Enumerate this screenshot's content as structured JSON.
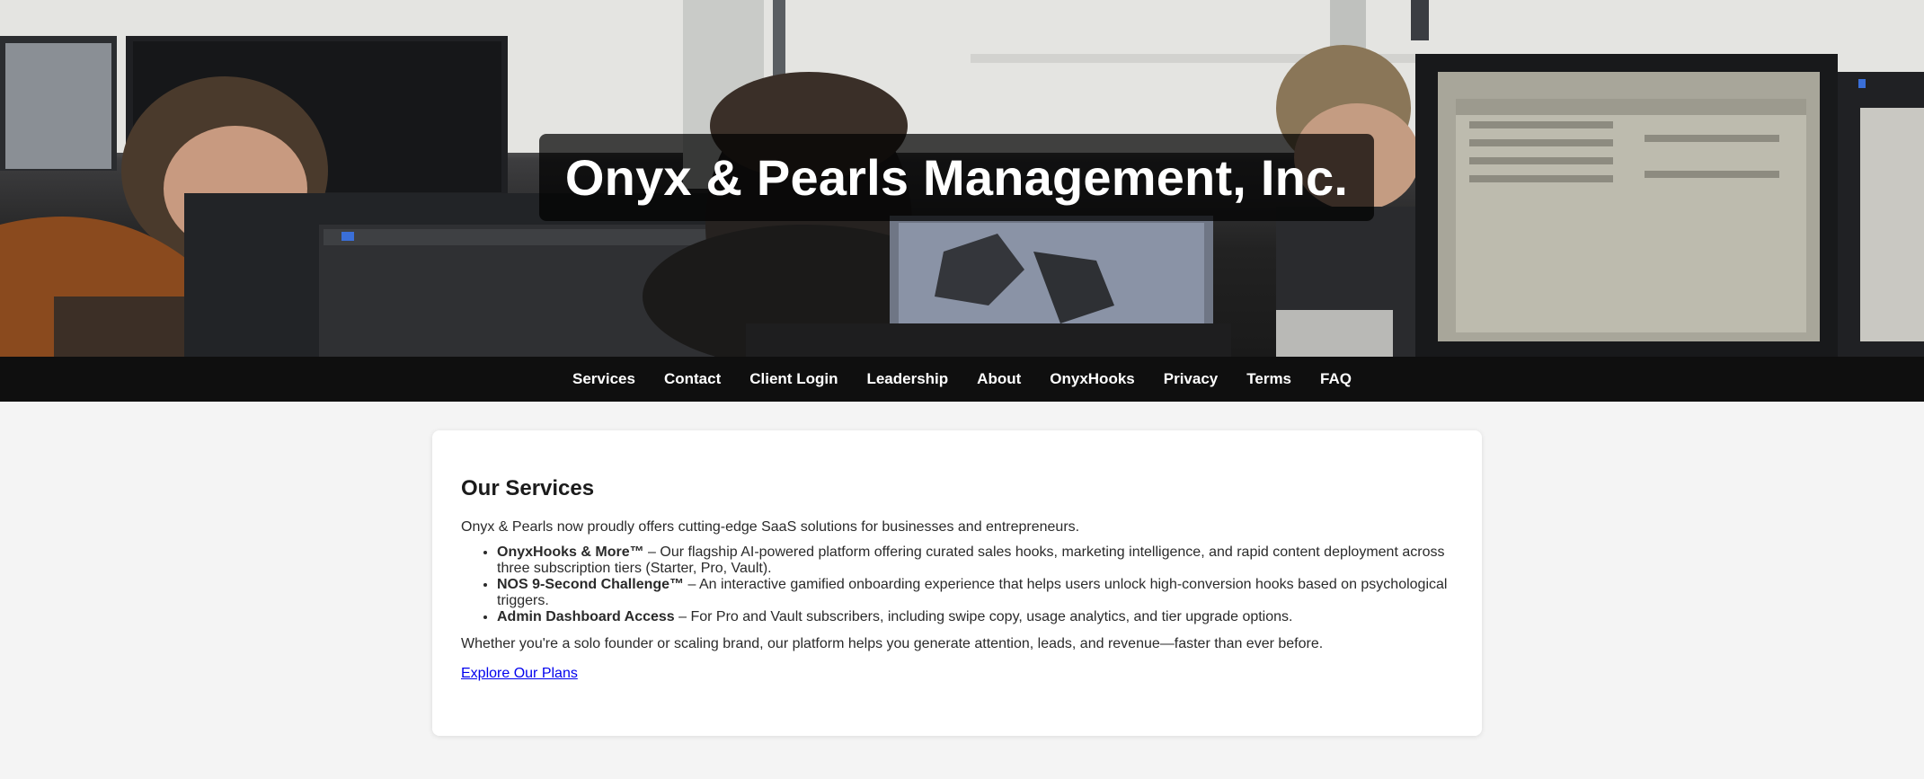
{
  "hero": {
    "title": "Onyx & Pearls Management, Inc."
  },
  "nav": {
    "items": [
      "Services",
      "Contact",
      "Client Login",
      "Leadership",
      "About",
      "OnyxHooks",
      "Privacy",
      "Terms",
      "FAQ"
    ]
  },
  "services": {
    "heading": "Our Services",
    "intro": "Onyx & Pearls now proudly offers cutting-edge SaaS solutions for businesses and entrepreneurs.",
    "items": [
      {
        "name": "OnyxHooks & More™",
        "description": " – Our flagship AI-powered platform offering curated sales hooks, marketing intelligence, and rapid content deployment across three subscription tiers (Starter, Pro, Vault)."
      },
      {
        "name": "NOS 9-Second Challenge™",
        "description": " – An interactive gamified onboarding experience that helps users unlock high-conversion hooks based on psychological triggers."
      },
      {
        "name": "Admin Dashboard Access",
        "description": " – For Pro and Vault subscribers, including swipe copy, usage analytics, and tier upgrade options."
      }
    ],
    "outro": "Whether you're a solo founder or scaling brand, our platform helps you generate attention, leads, and revenue—faster than ever before.",
    "cta": "Explore Our Plans"
  },
  "colors": {
    "nav_background": "#0f0f0f",
    "page_background": "#f4f4f4",
    "link": "#0000ee"
  }
}
